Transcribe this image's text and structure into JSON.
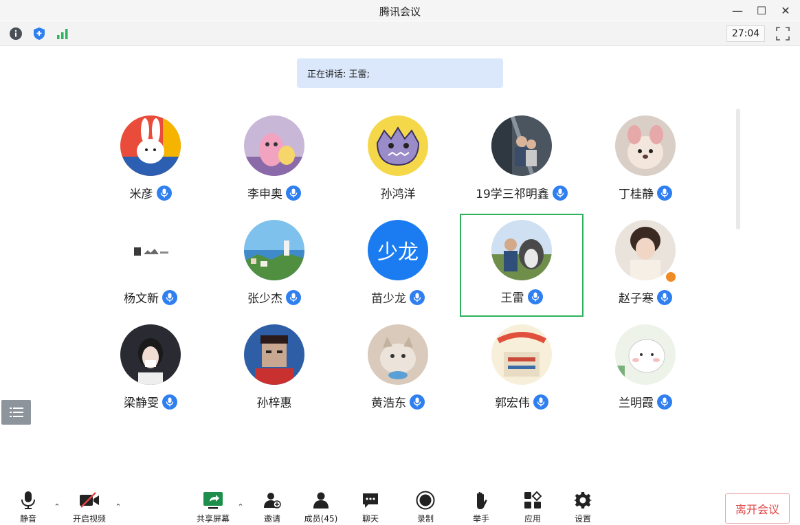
{
  "window": {
    "title": "腾讯会议",
    "minimize": "—",
    "maximize": "☐",
    "close": "✕"
  },
  "infobar": {
    "timer": "27:04"
  },
  "speaking": {
    "text": "正在讲话: 王雷;"
  },
  "participants": [
    {
      "name": "米彦",
      "mic": true
    },
    {
      "name": "李申奥",
      "mic": true
    },
    {
      "name": "孙鸿洋",
      "mic": false
    },
    {
      "name": "19学三祁明鑫",
      "mic": true
    },
    {
      "name": "丁桂静",
      "mic": true
    },
    {
      "name": "杨文新",
      "mic": true
    },
    {
      "name": "张少杰",
      "mic": true
    },
    {
      "name": "苗少龙",
      "mic": true,
      "avatar_text": "少龙"
    },
    {
      "name": "王雷",
      "mic": true,
      "speaking": true
    },
    {
      "name": "赵子寒",
      "mic": true,
      "host": true
    },
    {
      "name": "梁静雯",
      "mic": true
    },
    {
      "name": "孙梓惠",
      "mic": false
    },
    {
      "name": "黄浩东",
      "mic": true
    },
    {
      "name": "郭宏伟",
      "mic": true
    },
    {
      "name": "兰明霞",
      "mic": true
    }
  ],
  "toolbar": {
    "mute": "静音",
    "video": "开启视频",
    "share": "共享屏幕",
    "invite": "邀请",
    "members": "成员(45)",
    "chat": "聊天",
    "record": "录制",
    "raise_hand": "举手",
    "apps": "应用",
    "settings": "设置",
    "leave": "离开会议"
  },
  "colors": {
    "accent": "#2f7ff0",
    "speaking_border": "#2db35d",
    "leave": "#e04545",
    "banner": "#dbe8fb"
  }
}
